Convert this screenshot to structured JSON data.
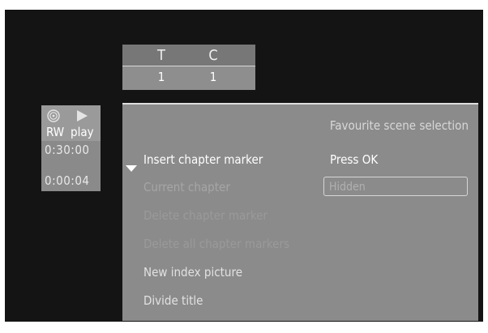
{
  "title_chapter": {
    "title_label": "T",
    "chapter_label": "C",
    "title_value": "1",
    "chapter_value": "1"
  },
  "status": {
    "disc_icon": "disc-icon",
    "play_icon": "play-icon",
    "disc_type": "RW",
    "mode": "play",
    "total_time": "0:30:00",
    "elapsed_time": "0:00:04"
  },
  "menu": {
    "title": "Favourite scene selection",
    "items": [
      {
        "label": "Insert chapter marker"
      },
      {
        "label": "Current chapter"
      },
      {
        "label": "Delete chapter marker"
      },
      {
        "label": "Delete all chapter markers"
      },
      {
        "label": "New index picture"
      },
      {
        "label": "Divide title"
      }
    ],
    "press_ok": "Press OK",
    "current_chapter_value": "Hidden"
  }
}
